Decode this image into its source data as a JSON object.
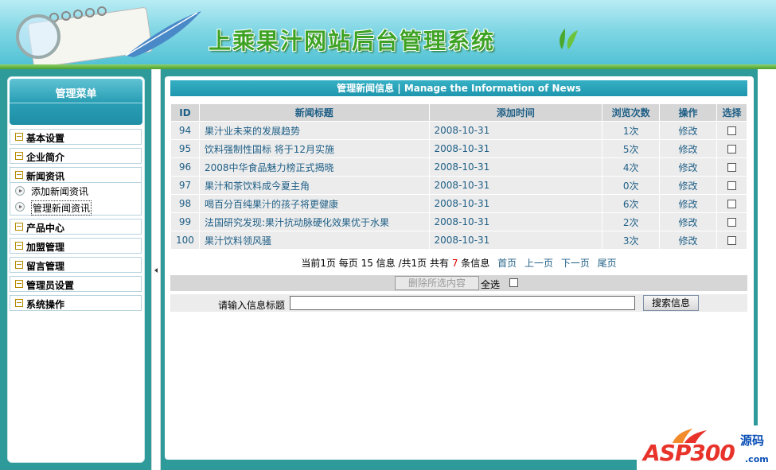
{
  "header": {
    "title": "上乘果汁网站后台管理系统"
  },
  "sidebar": {
    "title": "管理菜单",
    "sections": [
      {
        "label": "基本设置"
      },
      {
        "label": "企业简介"
      },
      {
        "label": "新闻资讯"
      },
      {
        "label": "产品中心"
      },
      {
        "label": "加盟管理"
      },
      {
        "label": "留言管理"
      },
      {
        "label": "管理员设置"
      },
      {
        "label": "系统操作"
      }
    ],
    "news_sub": [
      {
        "label": "添加新闻资讯"
      },
      {
        "label": "管理新闻资讯"
      }
    ]
  },
  "main": {
    "title": "管理新闻信息  | Manage the Information of News",
    "columns": [
      "ID",
      "新闻标题",
      "添加时间",
      "浏览次数",
      "操作",
      "选择"
    ],
    "rows": [
      {
        "id": "94",
        "title": "果汁业未来的发展趋势",
        "date": "2008-10-31",
        "views": "1次",
        "action": "修改"
      },
      {
        "id": "95",
        "title": "饮料强制性国标  将于12月实施",
        "date": "2008-10-31",
        "views": "5次",
        "action": "修改"
      },
      {
        "id": "96",
        "title": "2008中华食品魅力榜正式揭晓",
        "date": "2008-10-31",
        "views": "4次",
        "action": "修改"
      },
      {
        "id": "97",
        "title": "果汁和茶饮料成今夏主角",
        "date": "2008-10-31",
        "views": "0次",
        "action": "修改"
      },
      {
        "id": "98",
        "title": "喝百分百纯果汁的孩子将更健康",
        "date": "2008-10-31",
        "views": "6次",
        "action": "修改"
      },
      {
        "id": "99",
        "title": "法国研究发现:果汁抗动脉硬化效果优于水果",
        "date": "2008-10-31",
        "views": "2次",
        "action": "修改"
      },
      {
        "id": "100",
        "title": "果汁饮料领风骚",
        "date": "2008-10-31",
        "views": "3次",
        "action": "修改"
      }
    ],
    "pager": {
      "prefix": "当前1页  每页  15 信息  /共1页  共有",
      "count": "7",
      "suffix": "条信息",
      "first": "首页",
      "prev": "上一页",
      "next": "下一页",
      "last": "尾页"
    },
    "delete_label": "删除所选内容",
    "select_all_label": "全选",
    "search_label": "请输入信息标题",
    "search_value": "",
    "search_button": "搜索信息"
  },
  "watermark": {
    "logo": "ASP300",
    "sub": "源码",
    "com": ".com"
  },
  "colors": {
    "accent": "#1f96ae",
    "link": "#1f5f86",
    "title_green": "#3ea324"
  }
}
